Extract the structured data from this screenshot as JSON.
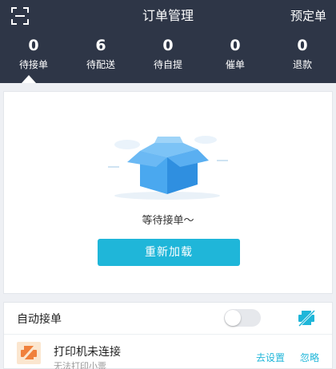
{
  "header": {
    "title": "订单管理",
    "reserve_label": "预定单",
    "scan_icon": "scan-icon"
  },
  "stats": [
    {
      "count": "0",
      "label": "待接单"
    },
    {
      "count": "6",
      "label": "待配送"
    },
    {
      "count": "0",
      "label": "待自提"
    },
    {
      "count": "0",
      "label": "催单"
    },
    {
      "count": "0",
      "label": "退款"
    }
  ],
  "empty_state": {
    "message": "等待接单～",
    "reload_label": "重新加载",
    "illustration": "empty-box-icon"
  },
  "auto_accept": {
    "label": "自动接单",
    "enabled": false,
    "printer_status_icon": "printer-disconnected-icon"
  },
  "printer": {
    "title": "打印机未连接",
    "subtitle": "无法打印小票",
    "setup_label": "去设置",
    "ignore_label": "忽略"
  },
  "colors": {
    "header_bg": "#2e3647",
    "accent": "#1fb6d9",
    "printer_icon_bg": "#fbe6cf",
    "printer_icon_fg": "#f0803c"
  }
}
